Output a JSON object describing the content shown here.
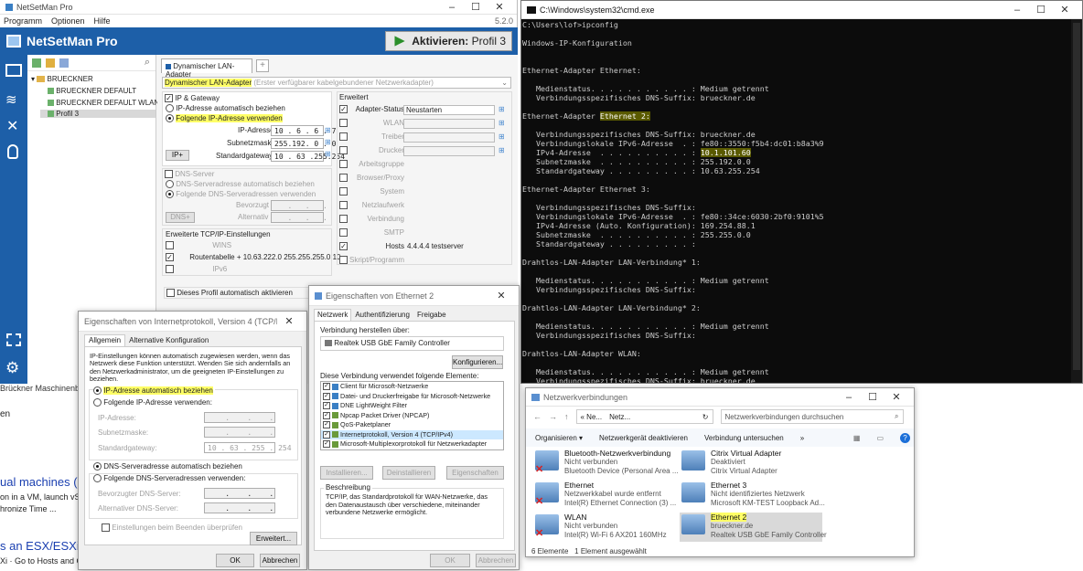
{
  "nsm": {
    "window_title": "NetSetMan Pro",
    "menu": [
      "Programm",
      "Optionen",
      "Hilfe"
    ],
    "version": "5.2.0",
    "header_title": "NetSetMan Pro",
    "activate_label": "Aktivieren:",
    "activate_profile": "Profil 3",
    "tree_root": "BRUECKNER",
    "profiles": [
      "BRUECKNER DEFAULT",
      "BRUECKNER DEFAULT WLAN",
      "Profil 3"
    ],
    "adapter_tab": "Dynamischer LAN-Adapter",
    "adapter_select": "Dynamischer LAN-Adapter",
    "adapter_select_hint": "(Erster verfügbarer kabelgebundener Netzwerkadapter)",
    "ip_gateway": "IP & Gateway",
    "ip_auto": "IP-Adresse automatisch beziehen",
    "ip_manual": "Folgende IP-Adresse verwenden",
    "ip_label": "IP-Adresse",
    "ip_value": "10 . 6 . 6 . 7",
    "subnet_label": "Subnetzmaske",
    "subnet_value": "255.192. 0 . 0",
    "gateway_label": "Standardgateway",
    "gateway_value": "10 . 63 .255.254",
    "ip_plus": "IP+",
    "dns_server": "DNS-Server",
    "dns_auto": "DNS-Serveradresse automatisch beziehen",
    "dns_manual": "Folgende DNS-Serveradressen verwenden",
    "dns_pref": "Bevorzugt",
    "dns_alt": "Alternativ",
    "dns_plus": "DNS+",
    "tcpip_title": "Erweiterte TCP/IP-Einstellungen",
    "wins": "WINS",
    "routing_label": "Routentabelle",
    "routing_value": "+ 10.63.222.0 255.255.255.0 10...",
    "ipv6": "IPv6",
    "erweitert": "Erweitert",
    "adv_items": [
      {
        "label": "Adapter-Status",
        "value": "Neustarten",
        "checked": true
      },
      {
        "label": "WLAN",
        "value": "",
        "checked": false
      },
      {
        "label": "Treiber",
        "value": "",
        "checked": false
      },
      {
        "label": "Drucker",
        "value": "",
        "checked": false
      },
      {
        "label": "Arbeitsgruppe",
        "value": "",
        "checked": false
      },
      {
        "label": "Browser/Proxy",
        "value": "",
        "checked": false
      },
      {
        "label": "System",
        "value": "",
        "checked": false
      },
      {
        "label": "Netzlaufwerk",
        "value": "",
        "checked": false
      },
      {
        "label": "Verbindung",
        "value": "",
        "checked": false
      },
      {
        "label": "SMTP",
        "value": "",
        "checked": false
      },
      {
        "label": "Hosts",
        "value": "4.4.4.4 testserver",
        "checked": true
      },
      {
        "label": "Skript/Programm",
        "value": "",
        "checked": false
      }
    ],
    "auto_activate": "Dieses Profil automatisch aktivieren"
  },
  "cmd": {
    "title": "C:\\Windows\\system32\\cmd.exe",
    "lines": [
      "C:\\Users\\lof>ipconfig",
      "",
      "Windows-IP-Konfiguration",
      "",
      "",
      "Ethernet-Adapter Ethernet:",
      "",
      "   Medienstatus. . . . . . . . . . . : Medium getrennt",
      "   Verbindungsspezifisches DNS-Suffix: brueckner.de",
      "",
      "Ethernet-Adapter Ethernet 2:",
      "",
      "   Verbindungsspezifisches DNS-Suffix: brueckner.de",
      "   Verbindungslokale IPv6-Adresse  . : fe80::3550:f5b4:dc01:b8a3%9",
      "   IPv4-Adresse  . . . . . . . . . . : 10.1.101.60",
      "   Subnetzmaske  . . . . . . . . . . : 255.192.0.0",
      "   Standardgateway . . . . . . . . . : 10.63.255.254",
      "",
      "Ethernet-Adapter Ethernet 3:",
      "",
      "   Verbindungsspezifisches DNS-Suffix:",
      "   Verbindungslokale IPv6-Adresse  . : fe80::34ce:6030:2bf0:9101%5",
      "   IPv4-Adresse (Auto. Konfiguration): 169.254.88.1",
      "   Subnetzmaske  . . . . . . . . . . : 255.255.0.0",
      "   Standardgateway . . . . . . . . . :",
      "",
      "Drahtlos-LAN-Adapter LAN-Verbindung* 1:",
      "",
      "   Medienstatus. . . . . . . . . . . : Medium getrennt",
      "   Verbindungsspezifisches DNS-Suffix:",
      "",
      "Drahtlos-LAN-Adapter LAN-Verbindung* 2:",
      "",
      "   Medienstatus. . . . . . . . . . . : Medium getrennt",
      "   Verbindungsspezifisches DNS-Suffix:",
      "",
      "Drahtlos-LAN-Adapter WLAN:",
      "",
      "   Medienstatus. . . . . . . . . . . : Medium getrennt",
      "   Verbindungsspezifisches DNS-Suffix: brueckner.de"
    ]
  },
  "tcpv4": {
    "title": "Eigenschaften von Internetprotokoll, Version 4 (TCP/IPv4)",
    "tabs": [
      "Allgemein",
      "Alternative Konfiguration"
    ],
    "desc": "IP-Einstellungen können automatisch zugewiesen werden, wenn das Netzwerk diese Funktion unterstützt. Wenden Sie sich andernfalls an den Netzwerkadministrator, um die geeigneten IP-Einstellungen zu beziehen.",
    "auto_ip": "IP-Adresse automatisch beziehen",
    "manual_ip": "Folgende IP-Adresse verwenden:",
    "ip": "IP-Adresse:",
    "subnet": "Subnetzmaske:",
    "gateway": "Standardgateway:",
    "gateway_value": "10 . 63 . 255 . 254",
    "auto_dns": "DNS-Serveradresse automatisch beziehen",
    "manual_dns": "Folgende DNS-Serveradressen verwenden:",
    "pref_dns": "Bevorzugter DNS-Server:",
    "alt_dns": "Alternativer DNS-Server:",
    "validate": "Einstellungen beim Beenden überprüfen",
    "advanced": "Erweitert...",
    "ok": "OK",
    "cancel": "Abbrechen"
  },
  "eth2": {
    "title": "Eigenschaften von Ethernet 2",
    "tabs": [
      "Netzwerk",
      "Authentifizierung",
      "Freigabe"
    ],
    "connect_using": "Verbindung herstellen über:",
    "adapter": "Realtek USB GbE Family Controller",
    "configure": "Konfigurieren...",
    "uses_label": "Diese Verbindung verwendet folgende Elemente:",
    "items": [
      "Client für Microsoft-Netzwerke",
      "Datei- und Druckerfreigabe für Microsoft-Netzwerke",
      "DNE LightWeight Filter",
      "Npcap Packet Driver (NPCAP)",
      "QoS-Paketplaner",
      "Internetprotokoll, Version 4 (TCP/IPv4)",
      "Microsoft-Multiplexorprotokoll für Netzwerkadapter"
    ],
    "install": "Installieren...",
    "uninstall": "Deinstallieren",
    "properties": "Eigenschaften",
    "desc_title": "Beschreibung",
    "desc": "TCP/IP, das Standardprotokoll für WAN-Netzwerke, das den Datenaustausch über verschiedene, miteinander verbundene Netzwerke ermöglicht.",
    "ok": "OK",
    "cancel": "Abbrechen"
  },
  "netconn": {
    "title": "Netzwerkverbindungen",
    "path": [
      "« Ne...",
      "Netz..."
    ],
    "search": "Netzwerkverbindungen durchsuchen",
    "toolbar": [
      "Organisieren ▾",
      "Netzwerkgerät deaktivieren",
      "Verbindung untersuchen",
      "»"
    ],
    "items": [
      {
        "name": "Bluetooth-Netzwerkverbindung",
        "status": "Nicht verbunden",
        "device": "Bluetooth Device (Personal Area ..."
      },
      {
        "name": "Citrix Virtual Adapter",
        "status": "Deaktiviert",
        "device": "Citrix Virtual Adapter"
      },
      {
        "name": "Ethernet",
        "status": "Netzwerkkabel wurde entfernt",
        "device": "Intel(R) Ethernet Connection (3) ..."
      },
      {
        "name": "Ethernet 3",
        "status": "Nicht identifiziertes Netzwerk",
        "device": "Microsoft KM-TEST Loopback Ad..."
      },
      {
        "name": "WLAN",
        "status": "Nicht verbunden",
        "device": "Intel(R) Wi-Fi 6 AX201 160MHz"
      },
      {
        "name": "Ethernet 2",
        "status": "brueckner.de",
        "device": "Realtek USB GbE Family Controller"
      }
    ],
    "count": "6 Elemente",
    "selected": "1 Element ausgewählt"
  },
  "bg": {
    "footer": "Brückner Maschinenbau G",
    "line1": "en",
    "line2": "ual machines (",
    "line3": "on in a VM, launch vS",
    "line4": "hronize Time ...",
    "line5": "s an ESX/ESXi",
    "line6": "Xi · Go to Hosts and C"
  }
}
